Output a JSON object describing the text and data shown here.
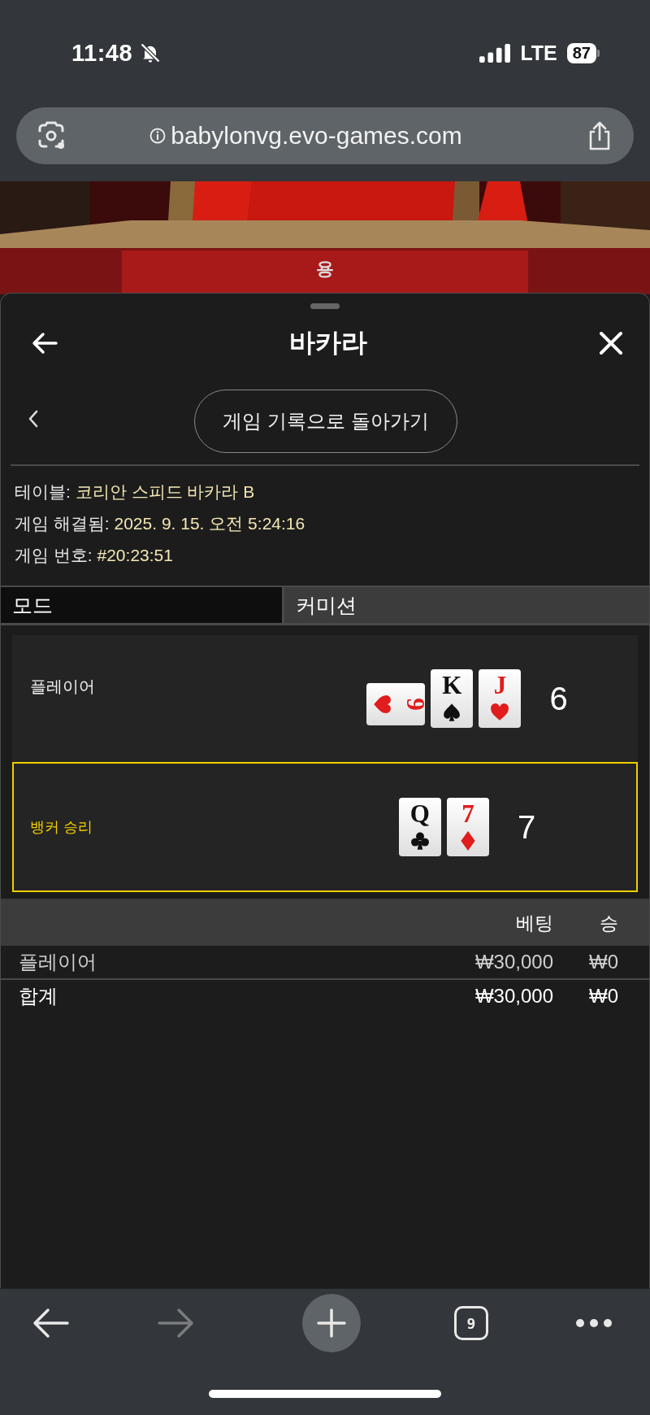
{
  "status_bar": {
    "time": "11:48",
    "network": "LTE",
    "battery": "87"
  },
  "browser": {
    "url": "babylonvg.evo-games.com"
  },
  "video": {
    "kind": "picture",
    "label": "용"
  },
  "sheet": {
    "title": "바카라",
    "back_to_history": "게임 기록으로 돌아가기",
    "info": [
      {
        "label": "테이블:",
        "value": "코리안 스피드 바카라 B"
      },
      {
        "label": "게임 해결됨:",
        "value": "2025. 9. 15. 오전 5:24:16"
      },
      {
        "label": "게임 번호:",
        "value": "#20:23:51"
      }
    ],
    "tabs": [
      {
        "label": "모드",
        "selected": true
      },
      {
        "label": "커미션",
        "selected": false
      }
    ],
    "hands": [
      {
        "label": "플레이어",
        "winner": false,
        "score": "6",
        "cards": [
          {
            "rank": "9",
            "kind": "hearts",
            "rotated": true
          },
          {
            "rank": "K",
            "kind": "spades",
            "rotated": false
          },
          {
            "rank": "J",
            "kind": "hearts",
            "rotated": false
          }
        ]
      },
      {
        "label": "뱅커 승리",
        "winner": true,
        "score": "7",
        "cards": [
          {
            "rank": "Q",
            "kind": "clubs",
            "rotated": false
          },
          {
            "rank": "7",
            "kind": "diamonds",
            "rotated": false
          }
        ]
      }
    ],
    "bets": {
      "columns": [
        "베팅",
        "승"
      ],
      "rows": [
        {
          "kind": "bet",
          "label": "플레이어",
          "bet": "₩30,000",
          "win": "₩0"
        },
        {
          "kind": "total",
          "label": "합계",
          "bet": "₩30,000",
          "win": "₩0"
        }
      ]
    }
  },
  "toolbar": {
    "tab_count": "9",
    "forward_enabled": false
  }
}
